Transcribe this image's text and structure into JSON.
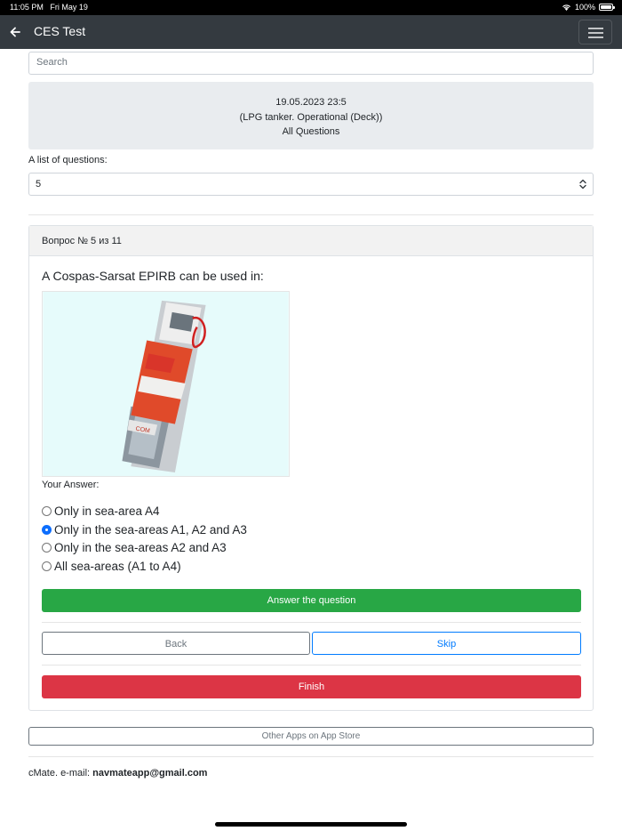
{
  "status_bar": {
    "time": "11:05 PM",
    "date": "Fri May 19",
    "battery": "100%"
  },
  "navbar": {
    "title": "CES Test"
  },
  "search": {
    "placeholder": "Search"
  },
  "info": {
    "line1": "19.05.2023 23:5",
    "line2": "(LPG tanker. Operational (Deck))",
    "line3": "All Questions"
  },
  "question_list": {
    "label": "A list of questions:",
    "selected": "5"
  },
  "card": {
    "header": "Вопрос № 5 из 11",
    "question": "A Cospas-Sarsat EPIRB can be used in:",
    "your_answer_label": "Your Answer:",
    "options": [
      {
        "label": "Only in sea-area A4",
        "checked": false
      },
      {
        "label": "Only in the sea-areas A1, A2 and A3",
        "checked": true
      },
      {
        "label": "Only in the sea-areas A2 and A3",
        "checked": false
      },
      {
        "label": "All sea-areas (A1 to A4)",
        "checked": false
      }
    ],
    "answer_button": "Answer the question",
    "back_button": "Back",
    "skip_button": "Skip",
    "finish_button": "Finish"
  },
  "other_apps_button": "Other Apps on App Store",
  "footer": {
    "prefix": "cMate. e-mail: ",
    "email": "navmateapp@gmail.com"
  }
}
